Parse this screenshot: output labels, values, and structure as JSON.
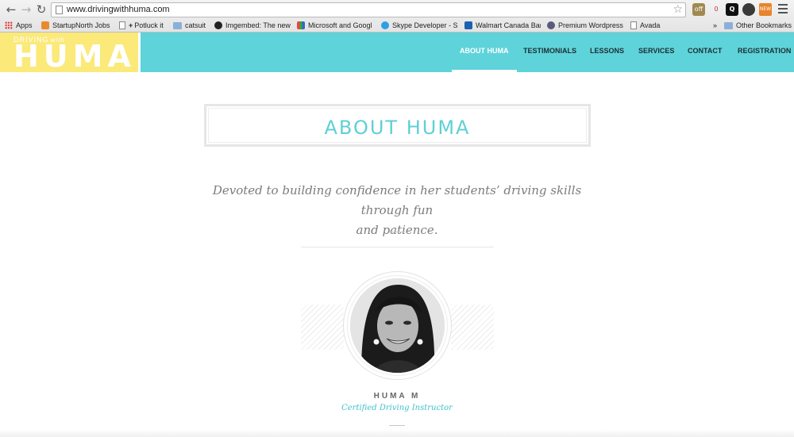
{
  "browser": {
    "url": "www.drivingwithhuma.com",
    "back_icon": "back-arrow-icon",
    "forward_icon": "forward-arrow-icon",
    "reload_icon": "reload-icon",
    "star_icon": "bookmark-star-icon",
    "extensions": [
      {
        "name": "extension-off-icon",
        "label": "off"
      },
      {
        "name": "extension-counter-icon",
        "label": "0"
      },
      {
        "name": "extension-q-icon",
        "label": "Q"
      },
      {
        "name": "extension-owl-icon",
        "label": ""
      },
      {
        "name": "extension-new-icon",
        "label": "NEW"
      }
    ],
    "bookmarks": [
      {
        "label": "Apps",
        "icon": "apps"
      },
      {
        "label": "StartupNorth Jobs",
        "icon": "orange"
      },
      {
        "label": "Potluck it",
        "icon": "page",
        "prefix": "+"
      },
      {
        "label": "catsuit",
        "icon": "folder"
      },
      {
        "label": "Imgembed: The new",
        "icon": "dark"
      },
      {
        "label": "Microsoft and Googl",
        "icon": "multi"
      },
      {
        "label": "Skype Developer - S",
        "icon": "skype"
      },
      {
        "label": "Walmart Canada Ban",
        "icon": "walmart"
      },
      {
        "label": "Premium Wordpress",
        "icon": "hp"
      },
      {
        "label": "Avada",
        "icon": "page"
      }
    ],
    "more_bookmarks": "»",
    "other_bookmarks": "Other Bookmarks"
  },
  "site": {
    "logo": {
      "small": "DRIVING",
      "with": "with",
      "big": "HUMA"
    },
    "nav": [
      {
        "label": "ABOUT HUMA",
        "active": true
      },
      {
        "label": "TESTIMONIALS",
        "active": false
      },
      {
        "label": "LESSONS",
        "active": false
      },
      {
        "label": "SERVICES",
        "active": false
      },
      {
        "label": "CONTACT",
        "active": false
      },
      {
        "label": "REGISTRATION",
        "active": false
      }
    ],
    "colors": {
      "header": "#5fd3da",
      "logo_bg": "#fbe97a",
      "accent": "#41c2cc"
    }
  },
  "about": {
    "title": "ABOUT HUMA",
    "tagline_line1": "Devoted to building confidence in her students’ driving skills through fun",
    "tagline_line2": "and patience.",
    "person_name": "HUMA M",
    "person_role": "Certified Driving Instructor"
  }
}
